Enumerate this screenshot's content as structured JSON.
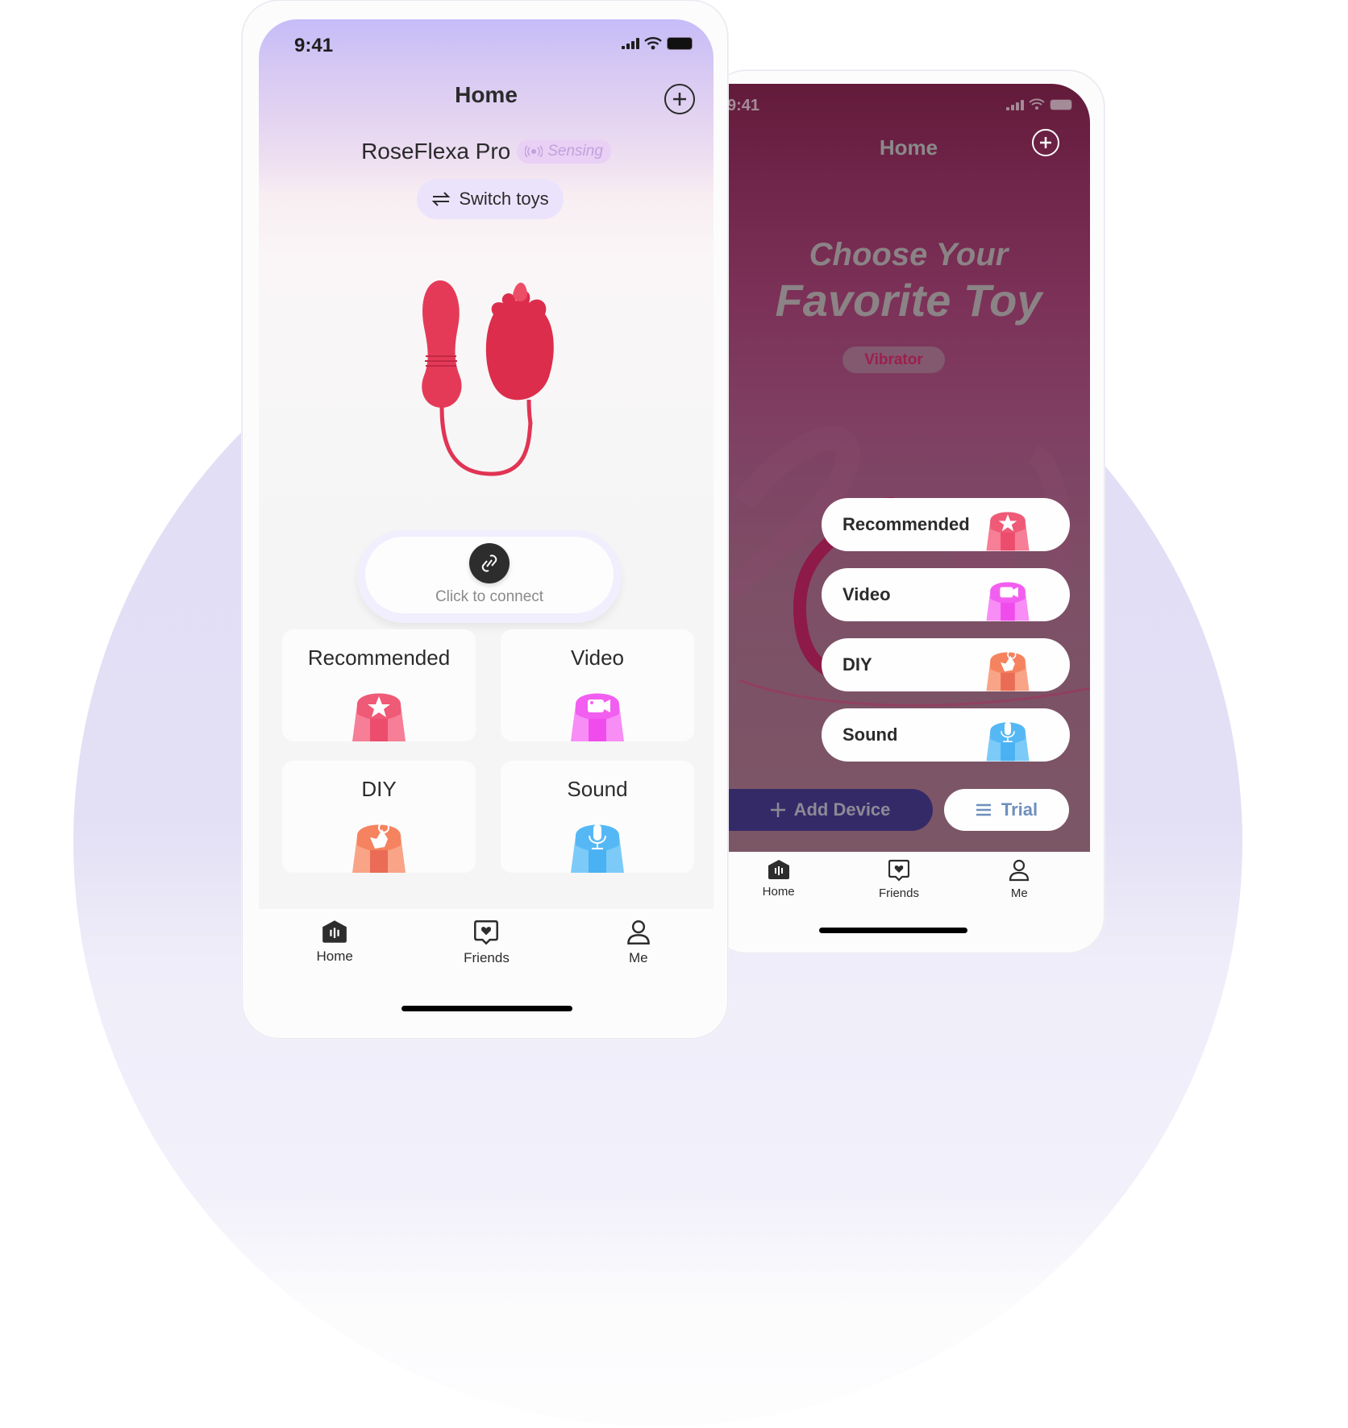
{
  "left_phone": {
    "status_bar": {
      "time": "9:41",
      "icons": [
        "cellular-signal-icon",
        "wifi-icon",
        "battery-icon"
      ]
    },
    "header": {
      "title": "Home",
      "add_icon": "plus-circle-icon"
    },
    "device": {
      "name": "RoseFlexa Pro",
      "status_badge": "Sensing",
      "status_icon": "broadcast-icon"
    },
    "switch_button": {
      "label": "Switch toys",
      "icon": "swap-arrows-icon"
    },
    "product_image": "rose-toy-image",
    "connect": {
      "label": "Click to connect",
      "icon": "link-icon"
    },
    "mode_cards": [
      {
        "label": "Recommended",
        "icon": "star-icon",
        "color": "#f0506e"
      },
      {
        "label": "Video",
        "icon": "video-camera-icon",
        "color": "#f24ef0"
      },
      {
        "label": "DIY",
        "icon": "tap-finger-icon",
        "color": "#f47a52"
      },
      {
        "label": "Sound",
        "icon": "microphone-icon",
        "color": "#4cb6f5"
      }
    ],
    "tab_bar": [
      {
        "label": "Home",
        "icon": "home-icon",
        "active": true
      },
      {
        "label": "Friends",
        "icon": "chat-heart-icon",
        "active": false
      },
      {
        "label": "Me",
        "icon": "person-icon",
        "active": false
      }
    ]
  },
  "right_phone": {
    "status_bar": {
      "time": "9:41",
      "icons": [
        "cellular-signal-icon",
        "wifi-icon",
        "battery-icon"
      ]
    },
    "header": {
      "title": "Home",
      "add_icon": "plus-circle-icon"
    },
    "hero": {
      "line1": "Choose Your",
      "line2": "Favorite Toy",
      "tag": "Vibrator"
    },
    "mode_pills": [
      {
        "label": "Recommended",
        "icon": "star-icon",
        "color": "#f0506e"
      },
      {
        "label": "Video",
        "icon": "video-camera-icon",
        "color": "#f24ef0"
      },
      {
        "label": "DIY",
        "icon": "tap-finger-icon",
        "color": "#f47a52"
      },
      {
        "label": "Sound",
        "icon": "microphone-icon",
        "color": "#4cb6f5"
      }
    ],
    "add_device_button": {
      "label": "Add Device",
      "icon": "plus-icon"
    },
    "trial_button": {
      "label": "Trial",
      "icon": "menu-lines-icon"
    },
    "tab_bar": [
      {
        "label": "Home",
        "icon": "home-icon",
        "active": true
      },
      {
        "label": "Friends",
        "icon": "chat-heart-icon",
        "active": false
      },
      {
        "label": "Me",
        "icon": "person-icon",
        "active": false
      }
    ]
  },
  "colors": {
    "left_header_gradient_top": "#c6bcf8",
    "right_screen_top": "#631b3a",
    "add_device_bg": "#352a68",
    "trial_text": "#6e8fbd",
    "background_circle": "#e2def5"
  }
}
